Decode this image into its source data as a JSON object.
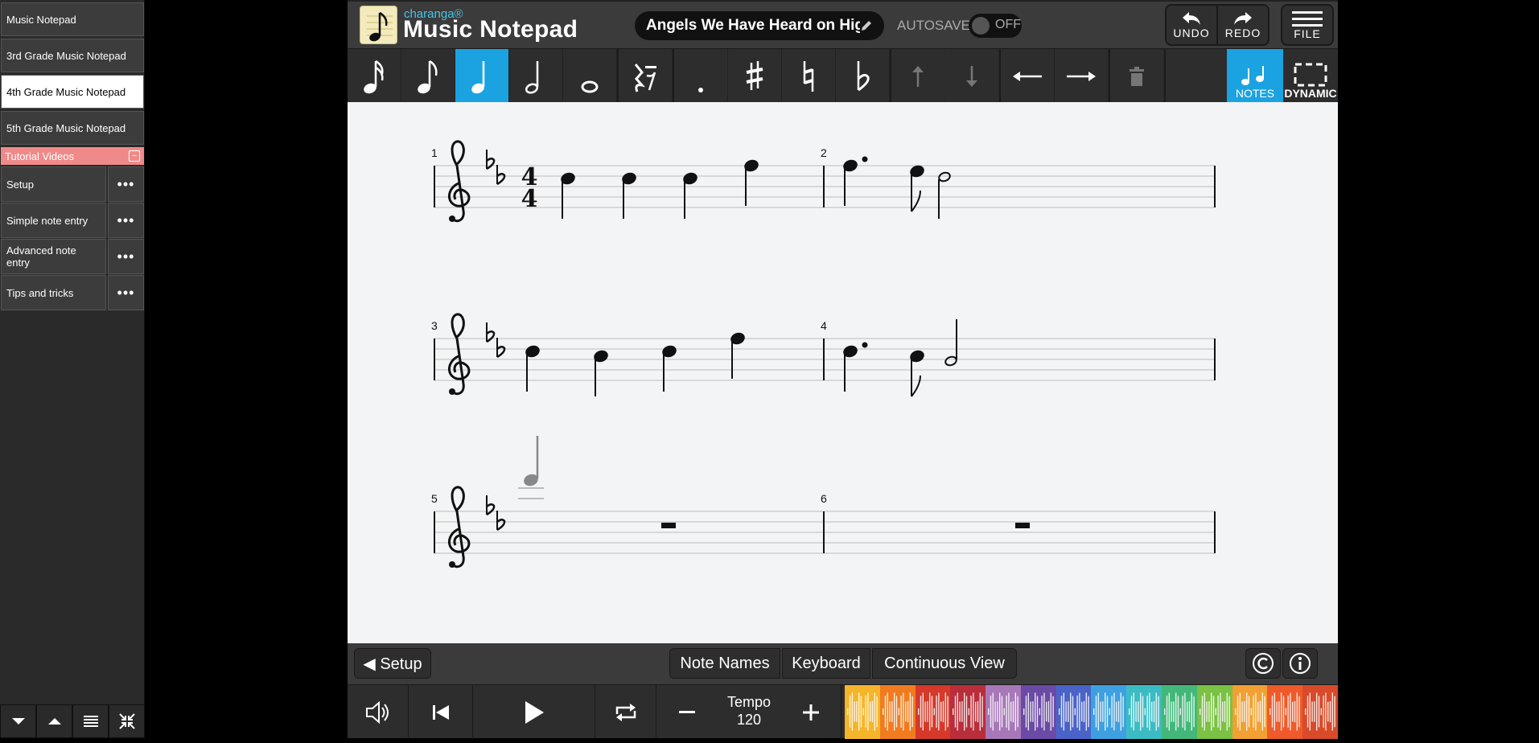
{
  "sidebar": {
    "items": [
      {
        "label": "Music Notepad"
      },
      {
        "label": "3rd Grade Music Notepad"
      },
      {
        "label": "4th Grade Music Notepad"
      },
      {
        "label": "5th Grade Music Notepad"
      }
    ],
    "section_title": "Tutorial Videos",
    "collapse_symbol": "−",
    "videos": [
      {
        "label": "Setup",
        "more": "•••"
      },
      {
        "label": "Simple note entry",
        "more": "•••"
      },
      {
        "label": "Advanced note entry",
        "more": "•••"
      },
      {
        "label": "Tips and tricks",
        "more": "•••"
      }
    ]
  },
  "header": {
    "brand_small": "charanga®",
    "brand_big": "Music Notepad",
    "song_title": "Angels We Have Heard on Hig",
    "autosave_label": "AUTOSAVE",
    "autosave_state": "OFF",
    "undo_label": "UNDO",
    "redo_label": "REDO",
    "file_label": "FILE"
  },
  "toolbar": {
    "selected_tool": "quarter-note",
    "notes_tab_label": "NOTES",
    "dynamic_tab_label": "DYNAMIC"
  },
  "score": {
    "measure_numbers": [
      "1",
      "2",
      "3",
      "4",
      "5",
      "6"
    ],
    "time_signature_top": "4",
    "time_signature_bottom": "4",
    "key_signature": "B-flat major (2 flats)"
  },
  "footer": {
    "setup_label": "◀ Setup",
    "note_names_label": "Note Names",
    "keyboard_label": "Keyboard",
    "continuous_view_label": "Continuous View",
    "tempo_label": "Tempo",
    "tempo_value": "120"
  },
  "colors": {
    "accent": "#1aa3e0",
    "tutorial_section": "#f08a8a",
    "brand_cyan": "#4ac3e8"
  }
}
